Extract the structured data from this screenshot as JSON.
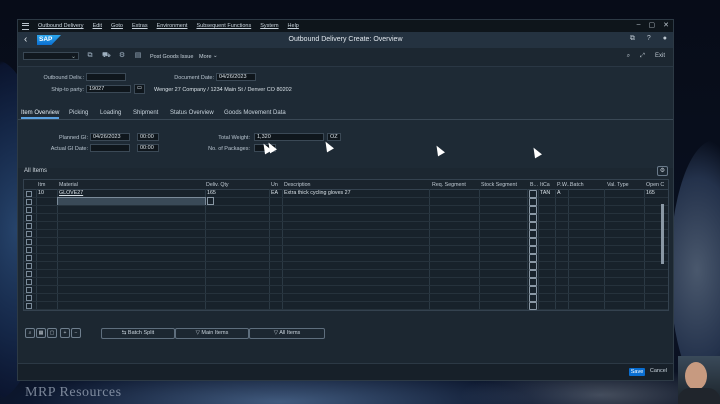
{
  "menu": {
    "items": [
      "Outbound Delivery",
      "Edit",
      "Goto",
      "Extras",
      "Environment",
      "Subsequent Functions",
      "System",
      "Help"
    ]
  },
  "app": {
    "title": "Outbound Delivery  Create: Overview",
    "logo_text": "SAP"
  },
  "toolbar": {
    "post_goods_issue": "Post Goods Issue",
    "more": "More",
    "exit": "Exit"
  },
  "header": {
    "outbound_deliv_label": "Outbound Deliv.:",
    "outbound_deliv_value": "",
    "doc_date_label": "Document Date:",
    "doc_date_value": "04/26/2023",
    "ship_to_label": "Ship-to party:",
    "ship_to_value": "19027",
    "ship_to_address": "Wenger 27 Company / 1234 Main St / Denver CO 80202"
  },
  "tabs": [
    "Item Overview",
    "Picking",
    "Loading",
    "Shipment",
    "Status Overview",
    "Goods Movement Data"
  ],
  "item_overview": {
    "planned_gi_label": "Planned GI:",
    "planned_gi_date": "04/26/2023",
    "planned_gi_time": "00:00",
    "actual_gi_label": "Actual GI Date:",
    "actual_gi_date": "",
    "actual_gi_time": "00:00",
    "total_weight_label": "Total Weight:",
    "total_weight_value": "1,320",
    "total_weight_unit": "OZ",
    "packages_label": "No. of Packages:",
    "packages_value": ""
  },
  "table": {
    "section_title": "All Items",
    "columns": [
      "Itm",
      "Material",
      "Deliv. Qty",
      "Un",
      "Description",
      "Req. Segment",
      "Stock Segment",
      "B...",
      "ItCa",
      "P...",
      "W...",
      "Batch",
      "Val. Type",
      "Open C"
    ],
    "rows": [
      {
        "itm": "10",
        "material": "GLOVE27",
        "qty": "165",
        "un": "EA",
        "description": "Extra thick cycling gloves 27",
        "itca": "TAN",
        "p": "A",
        "open": "165"
      }
    ]
  },
  "buttons": {
    "batch_split": "Batch Split",
    "main_items": "Main Items",
    "all_items": "All Items"
  },
  "footer": {
    "save": "Save",
    "cancel": "Cancel"
  },
  "background": {
    "watermark": "MRP Resources"
  },
  "colors": {
    "shell": "#1c2731",
    "accent": "#0a6ed1",
    "text": "#c8d3dc"
  }
}
